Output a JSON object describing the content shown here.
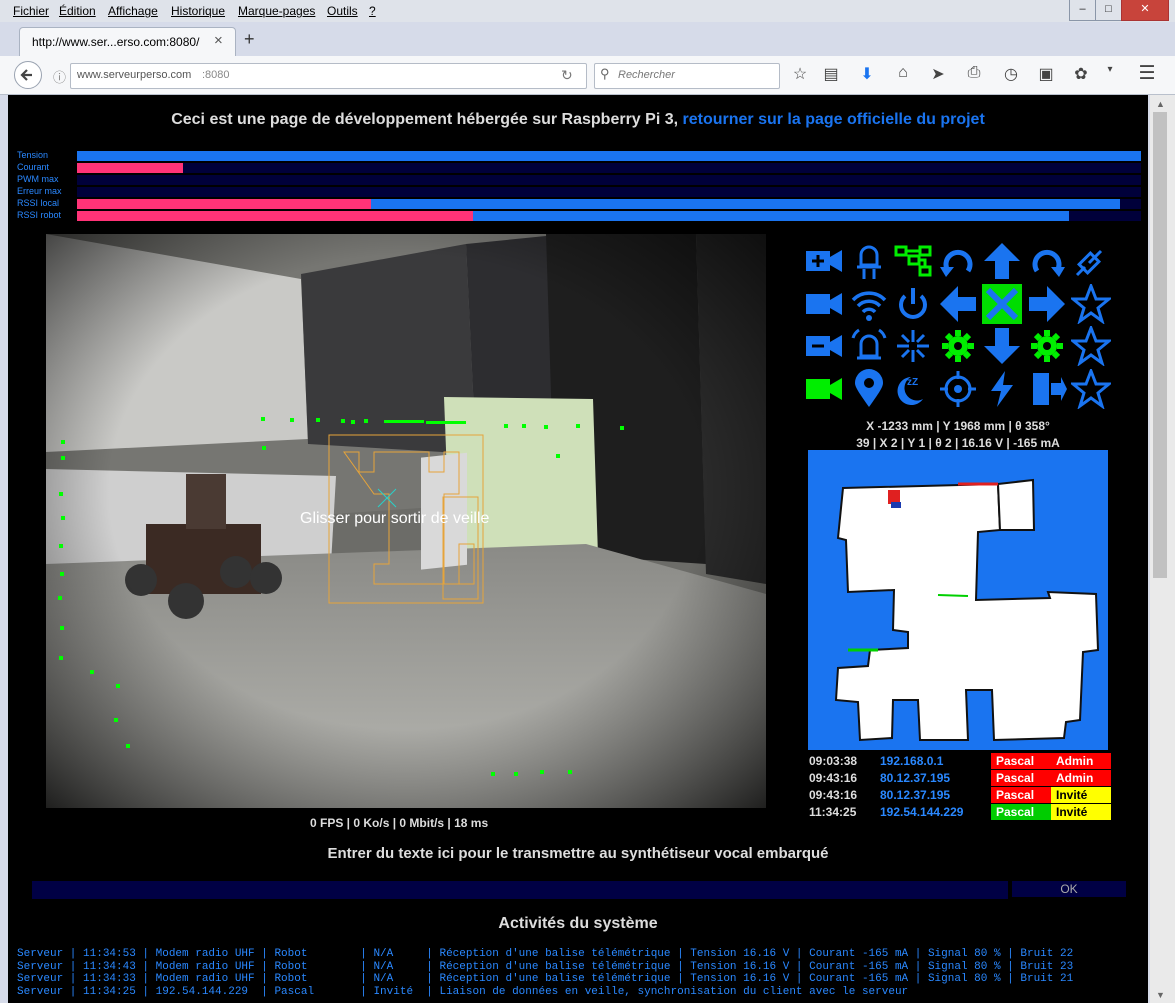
{
  "menu": [
    "Fichier",
    "Édition",
    "Affichage",
    "Historique",
    "Marque-pages",
    "Outils",
    "?"
  ],
  "tab": {
    "title": "http://www.ser...erso.com:8080/",
    "close": "×",
    "new": "+"
  },
  "url": {
    "host": "www.serveurperso.com",
    "port": ":8080"
  },
  "search": {
    "placeholder": "Rechercher"
  },
  "page": {
    "header_text": "Ceci est une page de développement hébergée sur Raspberry Pi 3,",
    "header_link": "retourner sur la page officielle du projet",
    "bars": [
      {
        "label": "Tension",
        "pink": 0,
        "blue": 1.0
      },
      {
        "label": "Courant",
        "pink": 0.1,
        "blue": 0.1
      },
      {
        "label": "PWM max",
        "pink": 0,
        "blue": 0
      },
      {
        "label": "Erreur max",
        "pink": 0,
        "blue": 0
      },
      {
        "label": "RSSI local",
        "pink": 0.276,
        "blue": 0.98
      },
      {
        "label": "RSSI robot",
        "pink": 0.372,
        "blue": 0.932
      }
    ],
    "video_overlay": "Glisser pour sortir de veille",
    "video_stats": "0 FPS | 0 Ko/s | 0 Mbit/s | 18 ms",
    "pose_line": "X -1233 mm | Y 1968 mm | θ 358°",
    "status_line": "39 | X 2 | Y 1 | θ 2 | 16.16 V | -165 mA",
    "sessions": [
      {
        "time": "09:03:38",
        "ip": "192.168.0.1",
        "user": "Pascal",
        "user_color": "#ff0000",
        "role": "Admin",
        "role_color": "#ff0000",
        "role_text_color": "#ffffff"
      },
      {
        "time": "09:43:16",
        "ip": "80.12.37.195",
        "user": "Pascal",
        "user_color": "#ff0000",
        "role": "Admin",
        "role_color": "#ff0000",
        "role_text_color": "#ffffff"
      },
      {
        "time": "09:43:16",
        "ip": "80.12.37.195",
        "user": "Pascal",
        "user_color": "#ff0000",
        "role": "Invité",
        "role_color": "#ffff00",
        "role_text_color": "#000000"
      },
      {
        "time": "11:34:25",
        "ip": "192.54.144.229",
        "user": "Pascal",
        "user_color": "#00cc00",
        "role": "Invité",
        "role_color": "#ffff00",
        "role_text_color": "#000000"
      }
    ],
    "tts_label": "Entrer du texte ici pour le transmettre au synthétiseur vocal embarqué",
    "ok_button": "OK",
    "activity_title": "Activités du système",
    "logs": [
      "Serveur | 11:34:53 | Modem radio UHF | Robot        | N/A     | Réception d'une balise télémétrique | Tension 16.16 V | Courant -165 mA | Signal 80 % | Bruit 22",
      "Serveur | 11:34:43 | Modem radio UHF | Robot        | N/A     | Réception d'une balise télémétrique | Tension 16.16 V | Courant -165 mA | Signal 80 % | Bruit 23",
      "Serveur | 11:34:33 | Modem radio UHF | Robot        | N/A     | Réception d'une balise télémétrique | Tension 16.16 V | Courant -165 mA | Signal 80 % | Bruit 21",
      "Serveur | 11:34:25 | 192.54.144.229  | Pascal       | Invité  | Liaison de données en veille, synchronisation du client avec le serveur"
    ],
    "icons": [
      "video-plus-icon",
      "led-icon",
      "circuit-icon",
      "rotate-left-icon",
      "arrow-up-icon",
      "rotate-right-icon",
      "plug-icon",
      "video-icon",
      "wifi-icon",
      "power-icon",
      "arrow-left-icon",
      "stop-icon",
      "arrow-right-icon",
      "star-icon",
      "video-minus-icon",
      "alarm-icon",
      "spark-icon",
      "gear-icon",
      "arrow-down-icon",
      "gear-icon",
      "star-icon",
      "video-green-icon",
      "map-pin-icon",
      "sleep-icon",
      "target-icon",
      "bolt-icon",
      "exit-icon",
      "star-icon"
    ],
    "colors": {
      "accent": "#1a74f0",
      "pink": "#ff3377",
      "track": "#00003a",
      "green": "#00ee00"
    }
  }
}
